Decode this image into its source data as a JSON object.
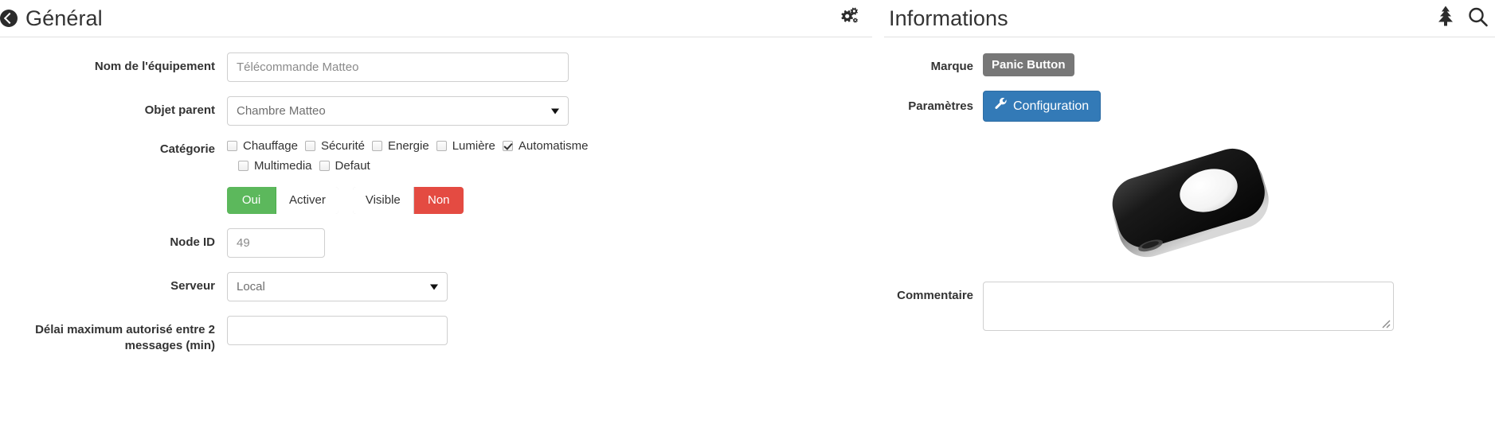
{
  "left_panel": {
    "title": "Général",
    "back_icon": "back-arrow-circle-icon",
    "gears_icon": "gears-icon",
    "fields": {
      "nom_label": "Nom de l'équipement",
      "nom_value": "Télécommande Matteo",
      "parent_label": "Objet parent",
      "parent_value": "Chambre Matteo",
      "categorie_label": "Catégorie",
      "node_label": "Node ID",
      "node_value": "49",
      "serveur_label": "Serveur",
      "serveur_value": "Local",
      "delai_label": "Délai maximum autorisé entre 2 messages (min)",
      "delai_value": ""
    },
    "categories_row1": [
      {
        "label": "Chauffage",
        "checked": false
      },
      {
        "label": "Sécurité",
        "checked": false
      },
      {
        "label": "Energie",
        "checked": false
      },
      {
        "label": "Lumière",
        "checked": false
      },
      {
        "label": "Automatisme",
        "checked": true
      }
    ],
    "categories_row2": [
      {
        "label": "Multimedia",
        "checked": false
      },
      {
        "label": "Defaut",
        "checked": false
      }
    ],
    "toggle_enable": {
      "on_label": "Oui",
      "off_label": "Activer",
      "state": "on",
      "color": "#5cb85c"
    },
    "toggle_visible": {
      "on_label": "Visible",
      "off_label": "Non",
      "state": "off",
      "color": "#e44b42"
    }
  },
  "right_panel": {
    "title": "Informations",
    "tree_icon": "tree-icon",
    "search_icon": "search-icon",
    "marque_label": "Marque",
    "marque_value": "Panic Button",
    "parametres_label": "Paramètres",
    "configuration_label": "Configuration",
    "wrench_icon": "wrench-icon",
    "device_image": "panic-button-keyfob-photo",
    "commentaire_label": "Commentaire",
    "commentaire_value": "",
    "commentaire_placeholder": ""
  }
}
